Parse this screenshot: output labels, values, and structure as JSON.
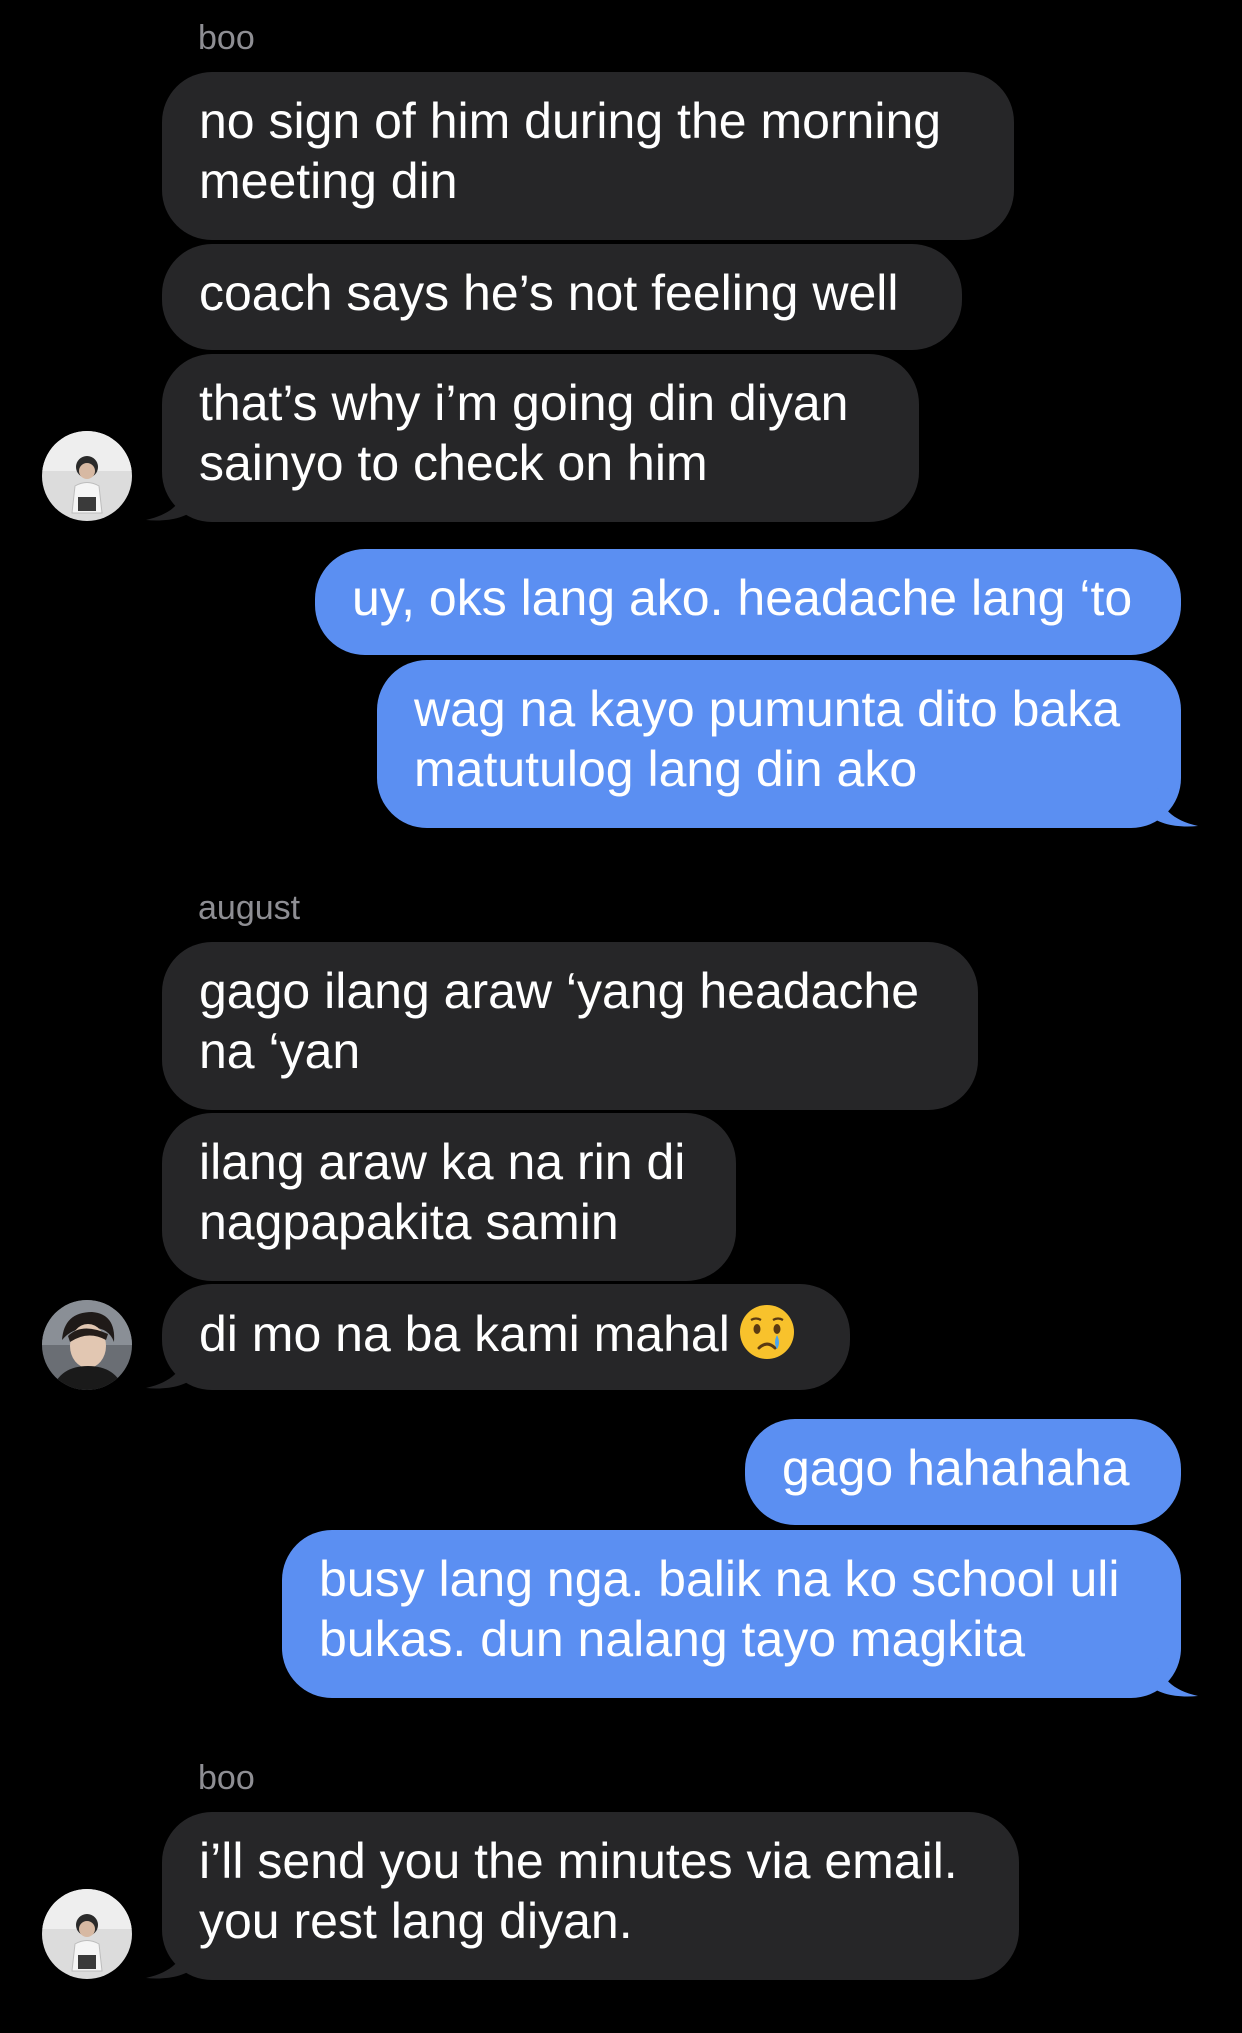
{
  "colors": {
    "background": "#000000",
    "incoming_bubble": "#262628",
    "outgoing_bubble": "#5b8ff2",
    "sender_label": "#8e8e93"
  },
  "conversation": {
    "group1": {
      "sender": "boo",
      "messages": [
        "no sign of him during the morning meeting din",
        "coach says he’s not feeling well",
        "that’s why i’m going din diyan sainyo to check on him"
      ],
      "avatar": "boo-avatar-icon"
    },
    "reply1": {
      "messages": [
        "uy, oks lang ako. headache lang ‘to",
        "wag na kayo pumunta dito baka matutulog lang din ako"
      ]
    },
    "group2": {
      "sender": "august",
      "messages": [
        "gago ilang araw ‘yang headache na ‘yan",
        "ilang araw ka na rin di nagpapakita samin",
        "di mo na ba kami mahal"
      ],
      "emoji": "crying-face-icon",
      "avatar": "august-avatar-icon"
    },
    "reply2": {
      "messages": [
        "gago hahahaha",
        "busy lang nga. balik na ko school uli bukas. dun nalang tayo magkita"
      ]
    },
    "group3": {
      "sender": "boo",
      "messages": [
        "i’ll send you the minutes via email. you rest lang diyan."
      ],
      "avatar": "boo-avatar-icon"
    }
  }
}
